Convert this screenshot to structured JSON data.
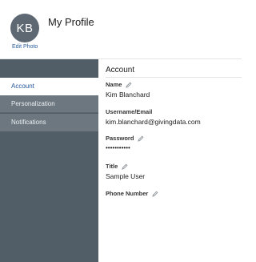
{
  "header": {
    "avatar_initials": "KB",
    "edit_photo_label": "Edit Photo",
    "title": "My Profile"
  },
  "sidebar": {
    "items": [
      {
        "label": "Account",
        "active": true
      },
      {
        "label": "Personalization",
        "active": false
      },
      {
        "label": "Notifications",
        "active": false
      }
    ]
  },
  "account": {
    "section_title": "Account",
    "fields": [
      {
        "label": "Name",
        "value": "Kim Blanchard",
        "editable": true
      },
      {
        "label": "Username/Email",
        "value": "kim.blanchard@givingdata.com",
        "editable": false
      },
      {
        "label": "Password",
        "value": "•••••••••••",
        "editable": true
      },
      {
        "label": "Title",
        "value": "Sample User",
        "editable": true
      },
      {
        "label": "Phone Number",
        "value": "",
        "editable": true
      }
    ]
  },
  "colors": {
    "sidebar_bg": "#525e67",
    "sidebar_item_bg": "#6c7780",
    "active_text": "#24569a",
    "avatar_bg": "#5d6873"
  },
  "icons": {
    "edit": "pencil-icon"
  }
}
